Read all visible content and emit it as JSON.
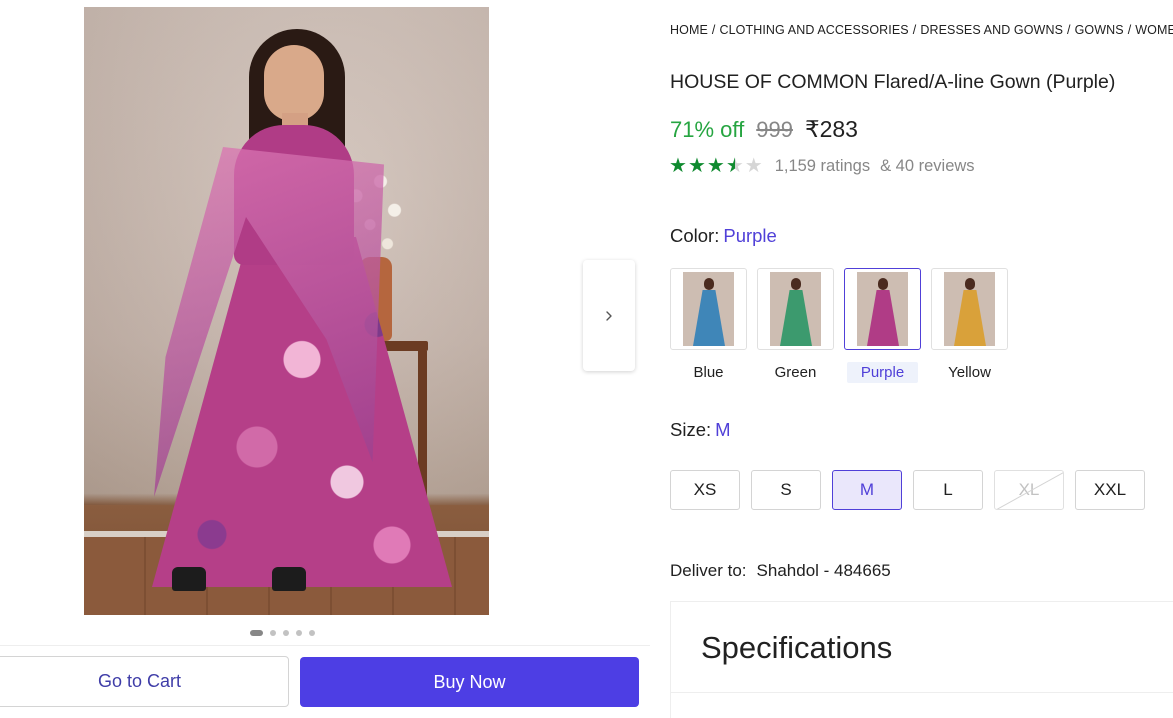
{
  "breadcrumb": [
    "HOME",
    "CLOTHING AND ACCESSORIES",
    "DRESSES AND GOWNS",
    "GOWNS",
    "WOMEN"
  ],
  "product": {
    "title": "HOUSE OF COMMON Flared/A-line Gown (Purple)",
    "discount": "71% off",
    "mrp": "999",
    "price": "₹283",
    "rating_value": 3.5,
    "rating_max": 5,
    "ratings_text": "1,159 ratings",
    "reviews_text": "& 40 reviews"
  },
  "gallery": {
    "image_count": 5,
    "active_index": 0,
    "next_icon": "chevron-right-icon"
  },
  "color": {
    "label": "Color:",
    "selected": "Purple",
    "options": [
      {
        "name": "Blue",
        "swatch": "#3f86b8"
      },
      {
        "name": "Green",
        "swatch": "#3c9a6e"
      },
      {
        "name": "Purple",
        "swatch": "#b03c86"
      },
      {
        "name": "Yellow",
        "swatch": "#d9a13a"
      }
    ]
  },
  "size": {
    "label": "Size:",
    "selected": "M",
    "options": [
      {
        "name": "XS",
        "available": true
      },
      {
        "name": "S",
        "available": true
      },
      {
        "name": "M",
        "available": true
      },
      {
        "name": "L",
        "available": true
      },
      {
        "name": "XL",
        "available": false
      },
      {
        "name": "XXL",
        "available": true
      }
    ]
  },
  "delivery": {
    "label": "Deliver to:",
    "location": "Shahdol - 484665"
  },
  "specifications": {
    "title": "Specifications"
  },
  "actions": {
    "go_to_cart": "Go to Cart",
    "buy_now": "Buy Now"
  },
  "colors": {
    "accent": "#4d3ee4",
    "discount_green": "#26a541",
    "star_green": "#0f8a2f",
    "selected_text": "#5040d8"
  }
}
